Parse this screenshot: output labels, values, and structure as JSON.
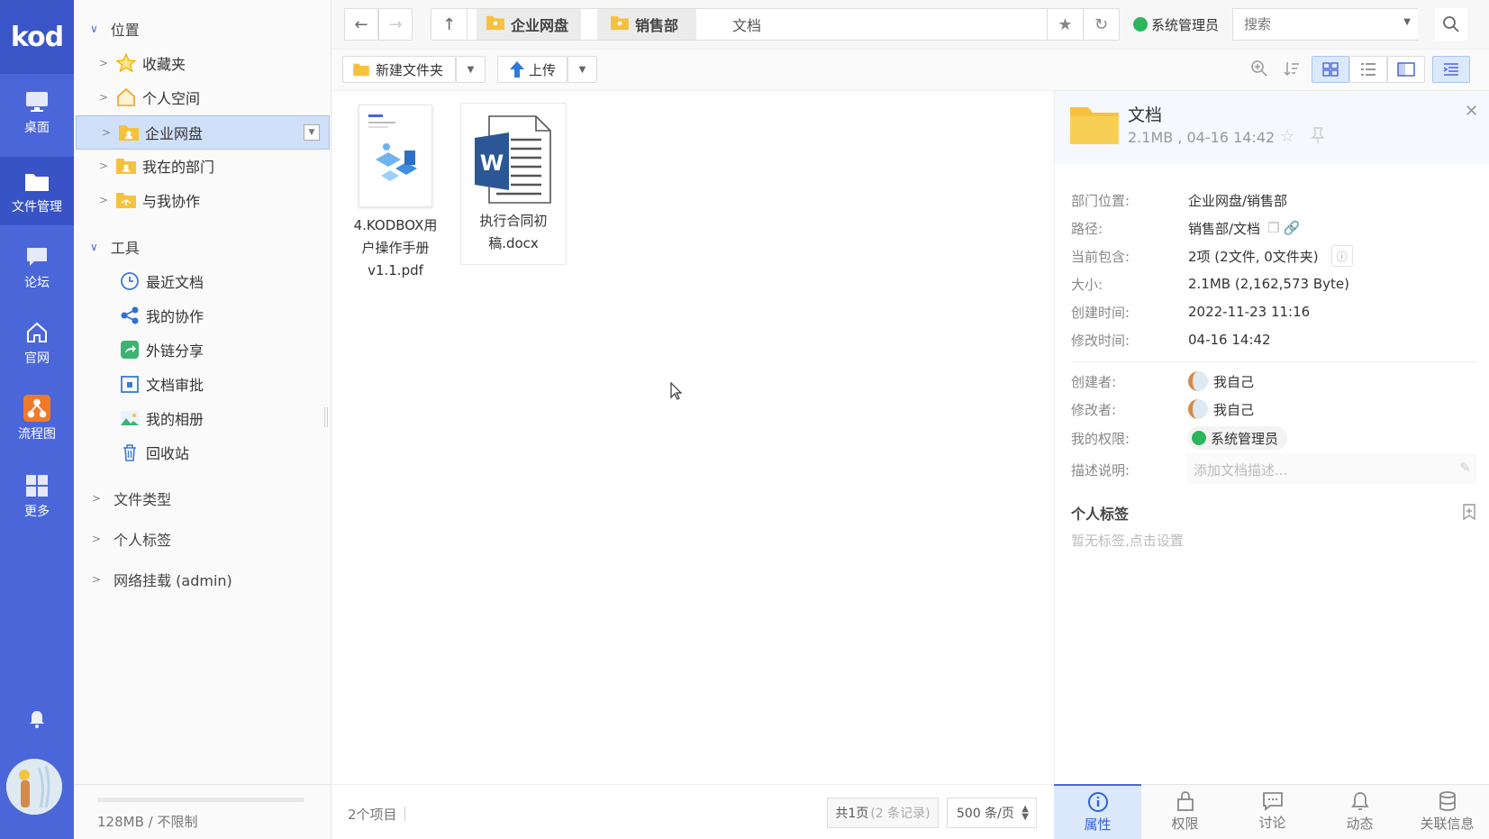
{
  "app": {
    "logo": "kod"
  },
  "rail": {
    "items": [
      {
        "label": "桌面",
        "icon": "desktop-icon"
      },
      {
        "label": "文件管理",
        "icon": "folder-icon"
      },
      {
        "label": "论坛",
        "icon": "forum-icon"
      },
      {
        "label": "官网",
        "icon": "home-icon"
      },
      {
        "label": "流程图",
        "icon": "flowchart-icon"
      },
      {
        "label": "更多",
        "icon": "grid-icon"
      }
    ],
    "bell_icon": "bell-icon"
  },
  "tree": {
    "section_location": "位置",
    "location_items": [
      "收藏夹",
      "个人空间",
      "企业网盘",
      "我在的部门",
      "与我协作"
    ],
    "section_tools": "工具",
    "tool_items": [
      "最近文档",
      "我的协作",
      "外链分享",
      "文档审批",
      "我的相册",
      "回收站"
    ],
    "file_types": "文件类型",
    "personal_tags": "个人标签",
    "network_mount": "网络挂载 (admin)",
    "storage": "128MB / 不限制"
  },
  "toolbar": {
    "crumbs": [
      "企业网盘",
      "销售部",
      "文档"
    ],
    "role": "系统管理员",
    "search_placeholder": "搜索",
    "new_folder": "新建文件夹",
    "upload": "上传"
  },
  "files": [
    {
      "name_line1": "4.KODBOX用",
      "name_line2": "户操作手册",
      "name_line3": "v1.1.pdf"
    },
    {
      "name_line1": "执行合同初",
      "name_line2": "稿.docx",
      "name_line3": ""
    }
  ],
  "status": {
    "count": "2个项目",
    "pager_prefix": "共1页",
    "pager_records": "(2 条记录)",
    "per_page": "500 条/页"
  },
  "props": {
    "title": "文档",
    "subtitle": "2.1MB , 04-16 14:42",
    "rows": [
      {
        "label": "部门位置:",
        "value": "企业网盘/销售部"
      },
      {
        "label": "路径:",
        "value": "销售部/文档"
      },
      {
        "label": "当前包含:",
        "value": "2项 (2文件, 0文件夹)"
      },
      {
        "label": "大小:",
        "value": "2.1MB (2,162,573 Byte)"
      },
      {
        "label": "创建时间:",
        "value": "2022-11-23 11:16"
      },
      {
        "label": "修改时间:",
        "value": "04-16 14:42"
      }
    ],
    "creator_label": "创建者:",
    "creator": "我自己",
    "modifier_label": "修改者:",
    "modifier": "我自己",
    "perm_label": "我的权限:",
    "perm": "系统管理员",
    "desc_label": "描述说明:",
    "desc_placeholder": "添加文档描述...",
    "tags_title": "个人标签",
    "tags_empty": "暂无标签,点击设置",
    "tabs": [
      "属性",
      "权限",
      "讨论",
      "动态",
      "关联信息"
    ]
  },
  "colors": {
    "accent": "#4a66d9",
    "folder": "#f6c23e",
    "green": "#2db55d"
  }
}
